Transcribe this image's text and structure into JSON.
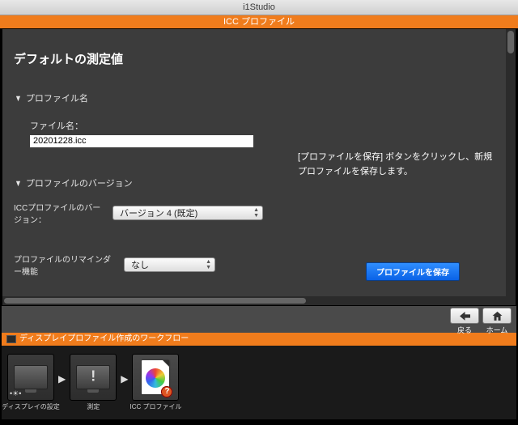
{
  "window": {
    "title": "i1Studio"
  },
  "header": {
    "module": "ICC プロファイル"
  },
  "page": {
    "heading": "デフォルトの測定値",
    "sections": {
      "profile_name": {
        "title": "プロファイル名",
        "filename_label": "ファイル名：",
        "filename_value": "20201228.icc"
      },
      "profile_version": {
        "title": "プロファイルのバージョン",
        "version_label": "ICCプロファイルのバージョン：",
        "version_value": "バージョン 4 (既定)",
        "reminder_label": "プロファイルのリマインダー機能",
        "reminder_value": "なし"
      }
    },
    "instruction": "[プロファイルを保存] ボタンをクリックし、新規プロファイルを保存します。",
    "save_button": "プロファイルを保存"
  },
  "nav": {
    "back": "戻る",
    "home": "ホーム"
  },
  "workflow": {
    "title": "ディスプレイプロファイル作成のワークフロー",
    "steps": [
      {
        "label": "ディスプレイの設定"
      },
      {
        "label": "測定"
      },
      {
        "label": "ICC プロファイル"
      }
    ]
  }
}
